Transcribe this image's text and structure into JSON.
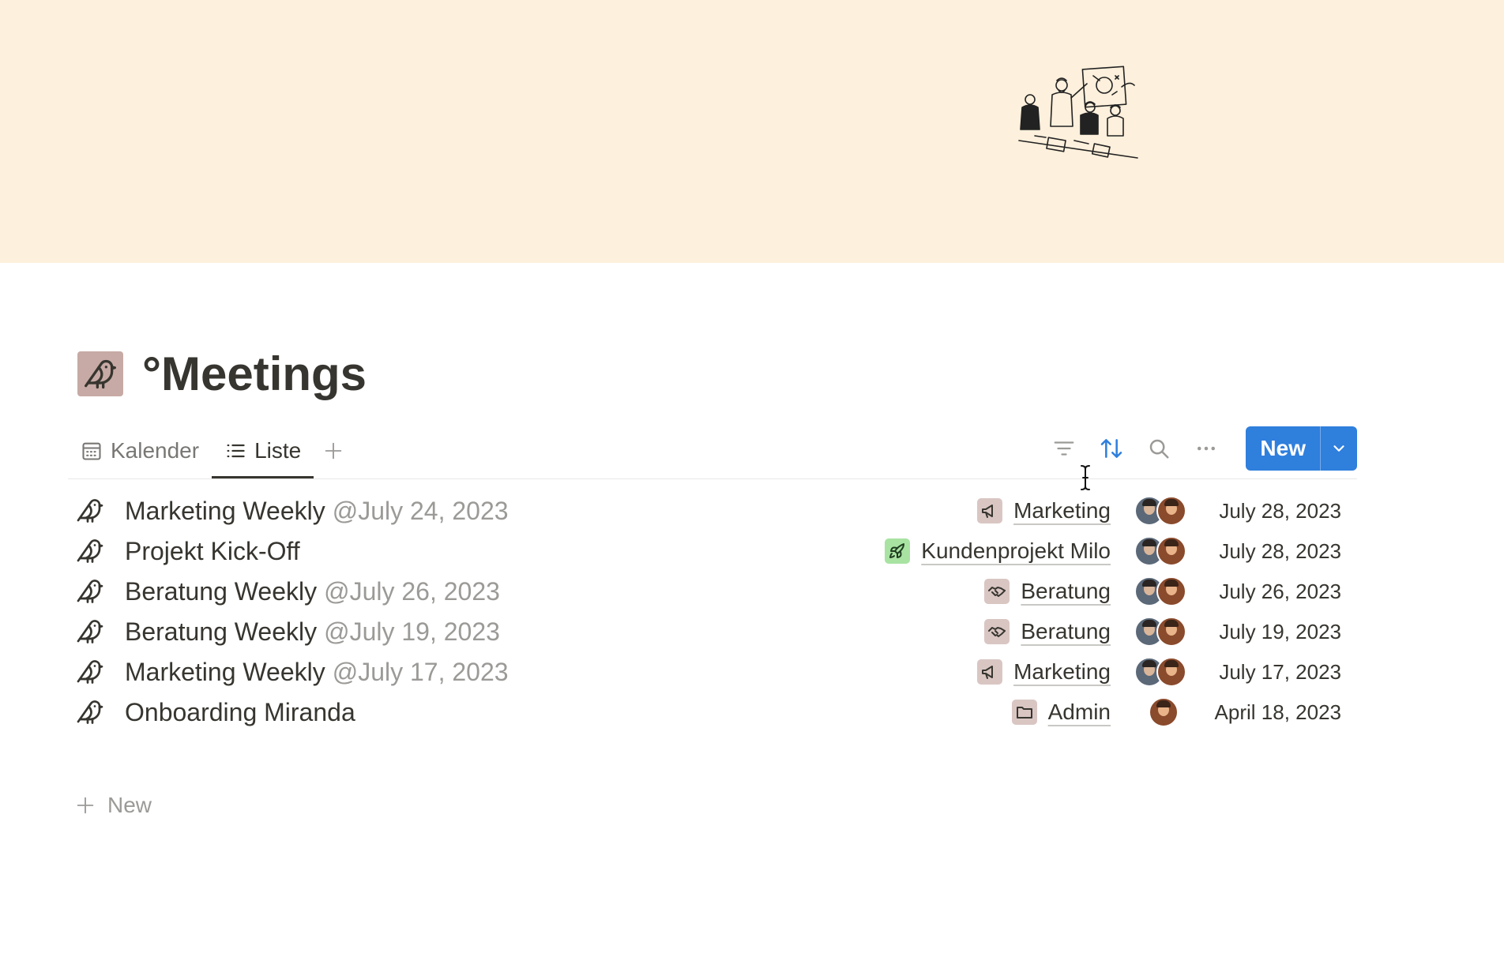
{
  "page": {
    "title": "°Meetings"
  },
  "views": {
    "tabs": [
      {
        "label": "Kalender",
        "icon": "calendar-icon",
        "active": false
      },
      {
        "label": "Liste",
        "icon": "list-icon",
        "active": true
      }
    ],
    "add_view_icon": "plus-icon"
  },
  "toolbar": {
    "filter_icon": "filter-icon",
    "sort_icon": "sort-icon",
    "search_icon": "search-icon",
    "more_icon": "more-icon",
    "new_label": "New",
    "new_dropdown_icon": "chevron-down-icon"
  },
  "rows": [
    {
      "title": "Marketing Weekly",
      "mention": "@July 24, 2023",
      "tag": "Marketing",
      "tag_icon": "megaphone-icon",
      "tag_color": "#d9c6c3",
      "avatars": 2,
      "date": "July 28, 2023"
    },
    {
      "title": "Projekt Kick-Off",
      "mention": "",
      "tag": "Kundenprojekt Milo",
      "tag_icon": "rocket-icon",
      "tag_color": "#a8e3a2",
      "avatars": 2,
      "date": "July 28, 2023"
    },
    {
      "title": "Beratung Weekly",
      "mention": "@July 26, 2023",
      "tag": "Beratung",
      "tag_icon": "handshake-icon",
      "tag_color": "#d9c6c3",
      "avatars": 2,
      "date": "July 26, 2023"
    },
    {
      "title": "Beratung Weekly",
      "mention": "@July 19, 2023",
      "tag": "Beratung",
      "tag_icon": "handshake-icon",
      "tag_color": "#d9c6c3",
      "avatars": 2,
      "date": "July 19, 2023"
    },
    {
      "title": "Marketing Weekly",
      "mention": "@July 17, 2023",
      "tag": "Marketing",
      "tag_icon": "megaphone-icon",
      "tag_color": "#d9c6c3",
      "avatars": 2,
      "date": "July 17, 2023"
    },
    {
      "title": "Onboarding Miranda",
      "mention": "",
      "tag": "Admin",
      "tag_icon": "folder-icon",
      "tag_color": "#d9c6c3",
      "avatars": 1,
      "date": "April 18, 2023"
    }
  ],
  "add_row": {
    "label": "New"
  },
  "colors": {
    "cover": "#fdf0dc",
    "accent": "#2f7fdd",
    "page_icon_bg": "#c7aaa5",
    "text": "#37352f",
    "muted": "#9b9a97"
  }
}
